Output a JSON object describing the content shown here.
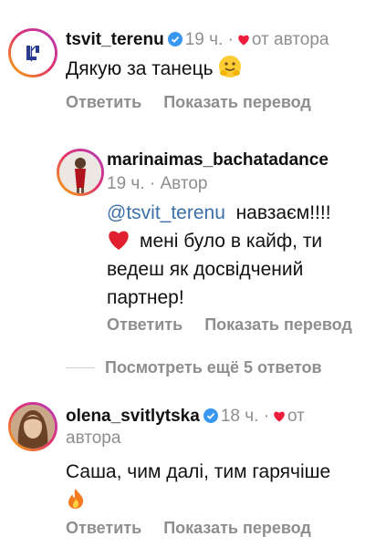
{
  "comments": [
    {
      "username": "tsvit_terenu",
      "time": "19 ч.",
      "dot": "·",
      "author_tag": "от автора",
      "text": "Дякую за танець",
      "emoji": "hugging-face",
      "reply": "Ответить",
      "translate": "Показать перевод"
    },
    {
      "username": "marinaimas_bachatadance",
      "time": "19 ч.",
      "dot": "·",
      "author_tag": "Автор",
      "mention": "@tsvit_terenu",
      "text_line1": "навзаєм!!!!",
      "text_line2": "мені було в кайф, ти",
      "text_line3": "ведеш як досвідчений",
      "text_line4": "партнер!",
      "emoji": "red-heart",
      "reply": "Ответить",
      "translate": "Показать перевод"
    },
    {
      "username": "olena_svitlytska",
      "time": "18 ч.",
      "dot": "·",
      "author_tag_line1": "от",
      "author_tag_line2": "автора",
      "text": "Саша, чим далі, тим гарячіше",
      "emoji": "fire",
      "reply": "Ответить",
      "translate": "Показать перевод"
    }
  ],
  "more_replies": "Посмотреть ещё 5 ответов",
  "colors": {
    "muted": "#8e8e8e",
    "mention": "#3a6fa8",
    "verified": "#3897f0",
    "heart": "#ed1c3c"
  }
}
